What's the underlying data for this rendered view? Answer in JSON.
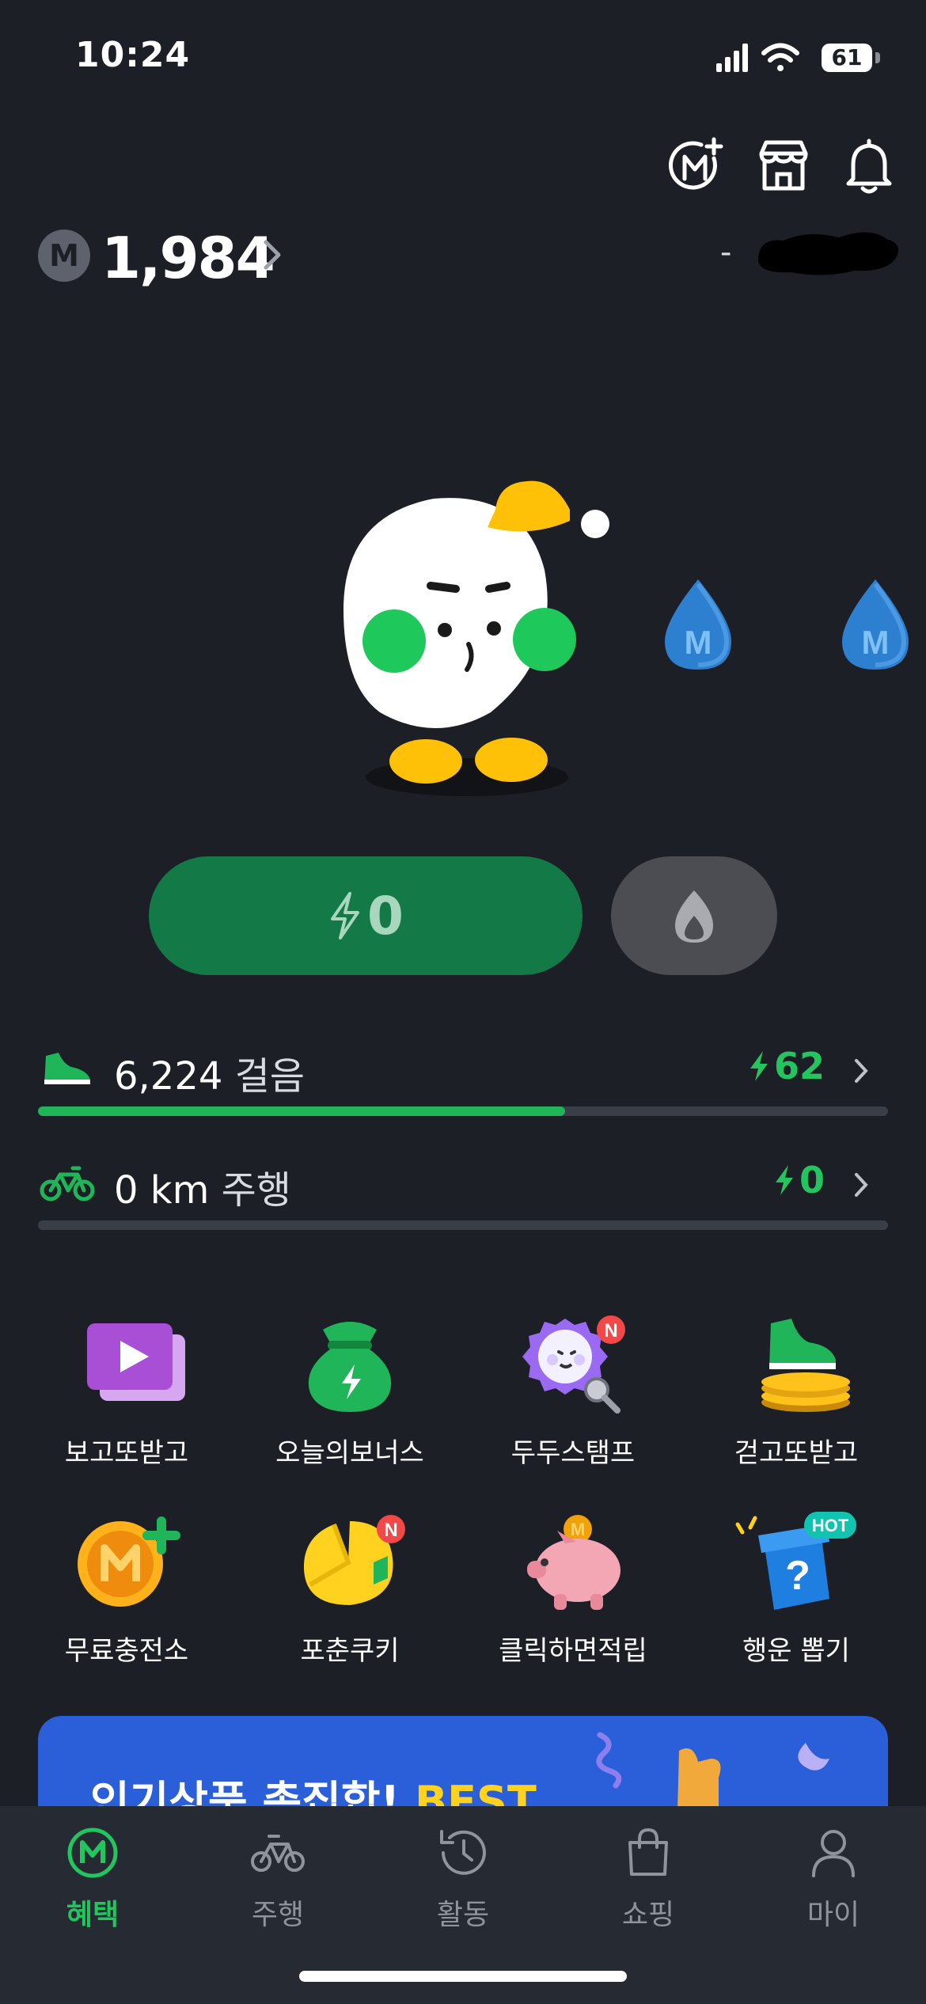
{
  "status_bar": {
    "time": "10:24",
    "battery": "61"
  },
  "header": {
    "icons": [
      "membership-add-icon",
      "store-icon",
      "bell-icon"
    ]
  },
  "points": {
    "coin_letter": "M",
    "value": "1,984"
  },
  "user": {
    "dash": "-"
  },
  "character": {
    "drop_letter": "M"
  },
  "energy": {
    "value": "0"
  },
  "activities": [
    {
      "value": "6,224",
      "unit": "걸음",
      "reward": "62",
      "progress": 0.62,
      "icon": "shoe-icon"
    },
    {
      "value": "0 km",
      "unit": "주행",
      "reward": "0",
      "progress": 0.0,
      "icon": "bicycle-icon"
    }
  ],
  "shortcuts": [
    {
      "label": "보고또받고",
      "icon": "video-play-icon"
    },
    {
      "label": "오늘의보너스",
      "icon": "money-pouch-icon"
    },
    {
      "label": "두두스탬프",
      "icon": "stamp-icon",
      "badge": "N"
    },
    {
      "label": "걷고또받고",
      "icon": "shoe-coins-icon"
    },
    {
      "label": "무료충전소",
      "icon": "coin-plus-icon"
    },
    {
      "label": "포춘쿠키",
      "icon": "fortune-cookie-icon",
      "badge": "N"
    },
    {
      "label": "클릭하면적립",
      "icon": "piggy-bank-icon"
    },
    {
      "label": "행운 뽑기",
      "icon": "lucky-box-icon",
      "badge": "HOT"
    }
  ],
  "banner": {
    "text": "인기상품 총집합!",
    "highlight": "BEST"
  },
  "nav": [
    {
      "label": "혜택",
      "icon": "benefit-icon",
      "active": true
    },
    {
      "label": "주행",
      "icon": "bicycle-icon",
      "active": false
    },
    {
      "label": "활동",
      "icon": "history-icon",
      "active": false
    },
    {
      "label": "쇼핑",
      "icon": "shopping-bag-icon",
      "active": false
    },
    {
      "label": "마이",
      "icon": "person-icon",
      "active": false
    }
  ],
  "colors": {
    "background": "#1c1f26",
    "accent_green": "#22c55e",
    "energy_button": "#127947",
    "banner": "#2a5fd9"
  }
}
